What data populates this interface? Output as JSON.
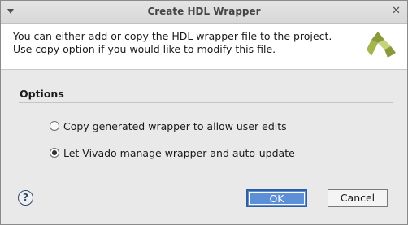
{
  "window": {
    "title": "Create HDL Wrapper"
  },
  "header": {
    "message": "You can either add or copy the HDL wrapper file to the project. Use copy option if you would like to modify this file."
  },
  "options": {
    "section_title": "Options",
    "radio_items": [
      {
        "label": "Copy generated wrapper to allow user edits",
        "selected": false
      },
      {
        "label": "Let Vivado manage wrapper and auto-update",
        "selected": true
      }
    ]
  },
  "footer": {
    "help_label": "?",
    "ok_label": "OK",
    "cancel_label": "Cancel"
  },
  "colors": {
    "ok_button": "#5c8fd6",
    "logo_dark": "#8a9a3a",
    "logo_light": "#c8d27a"
  }
}
